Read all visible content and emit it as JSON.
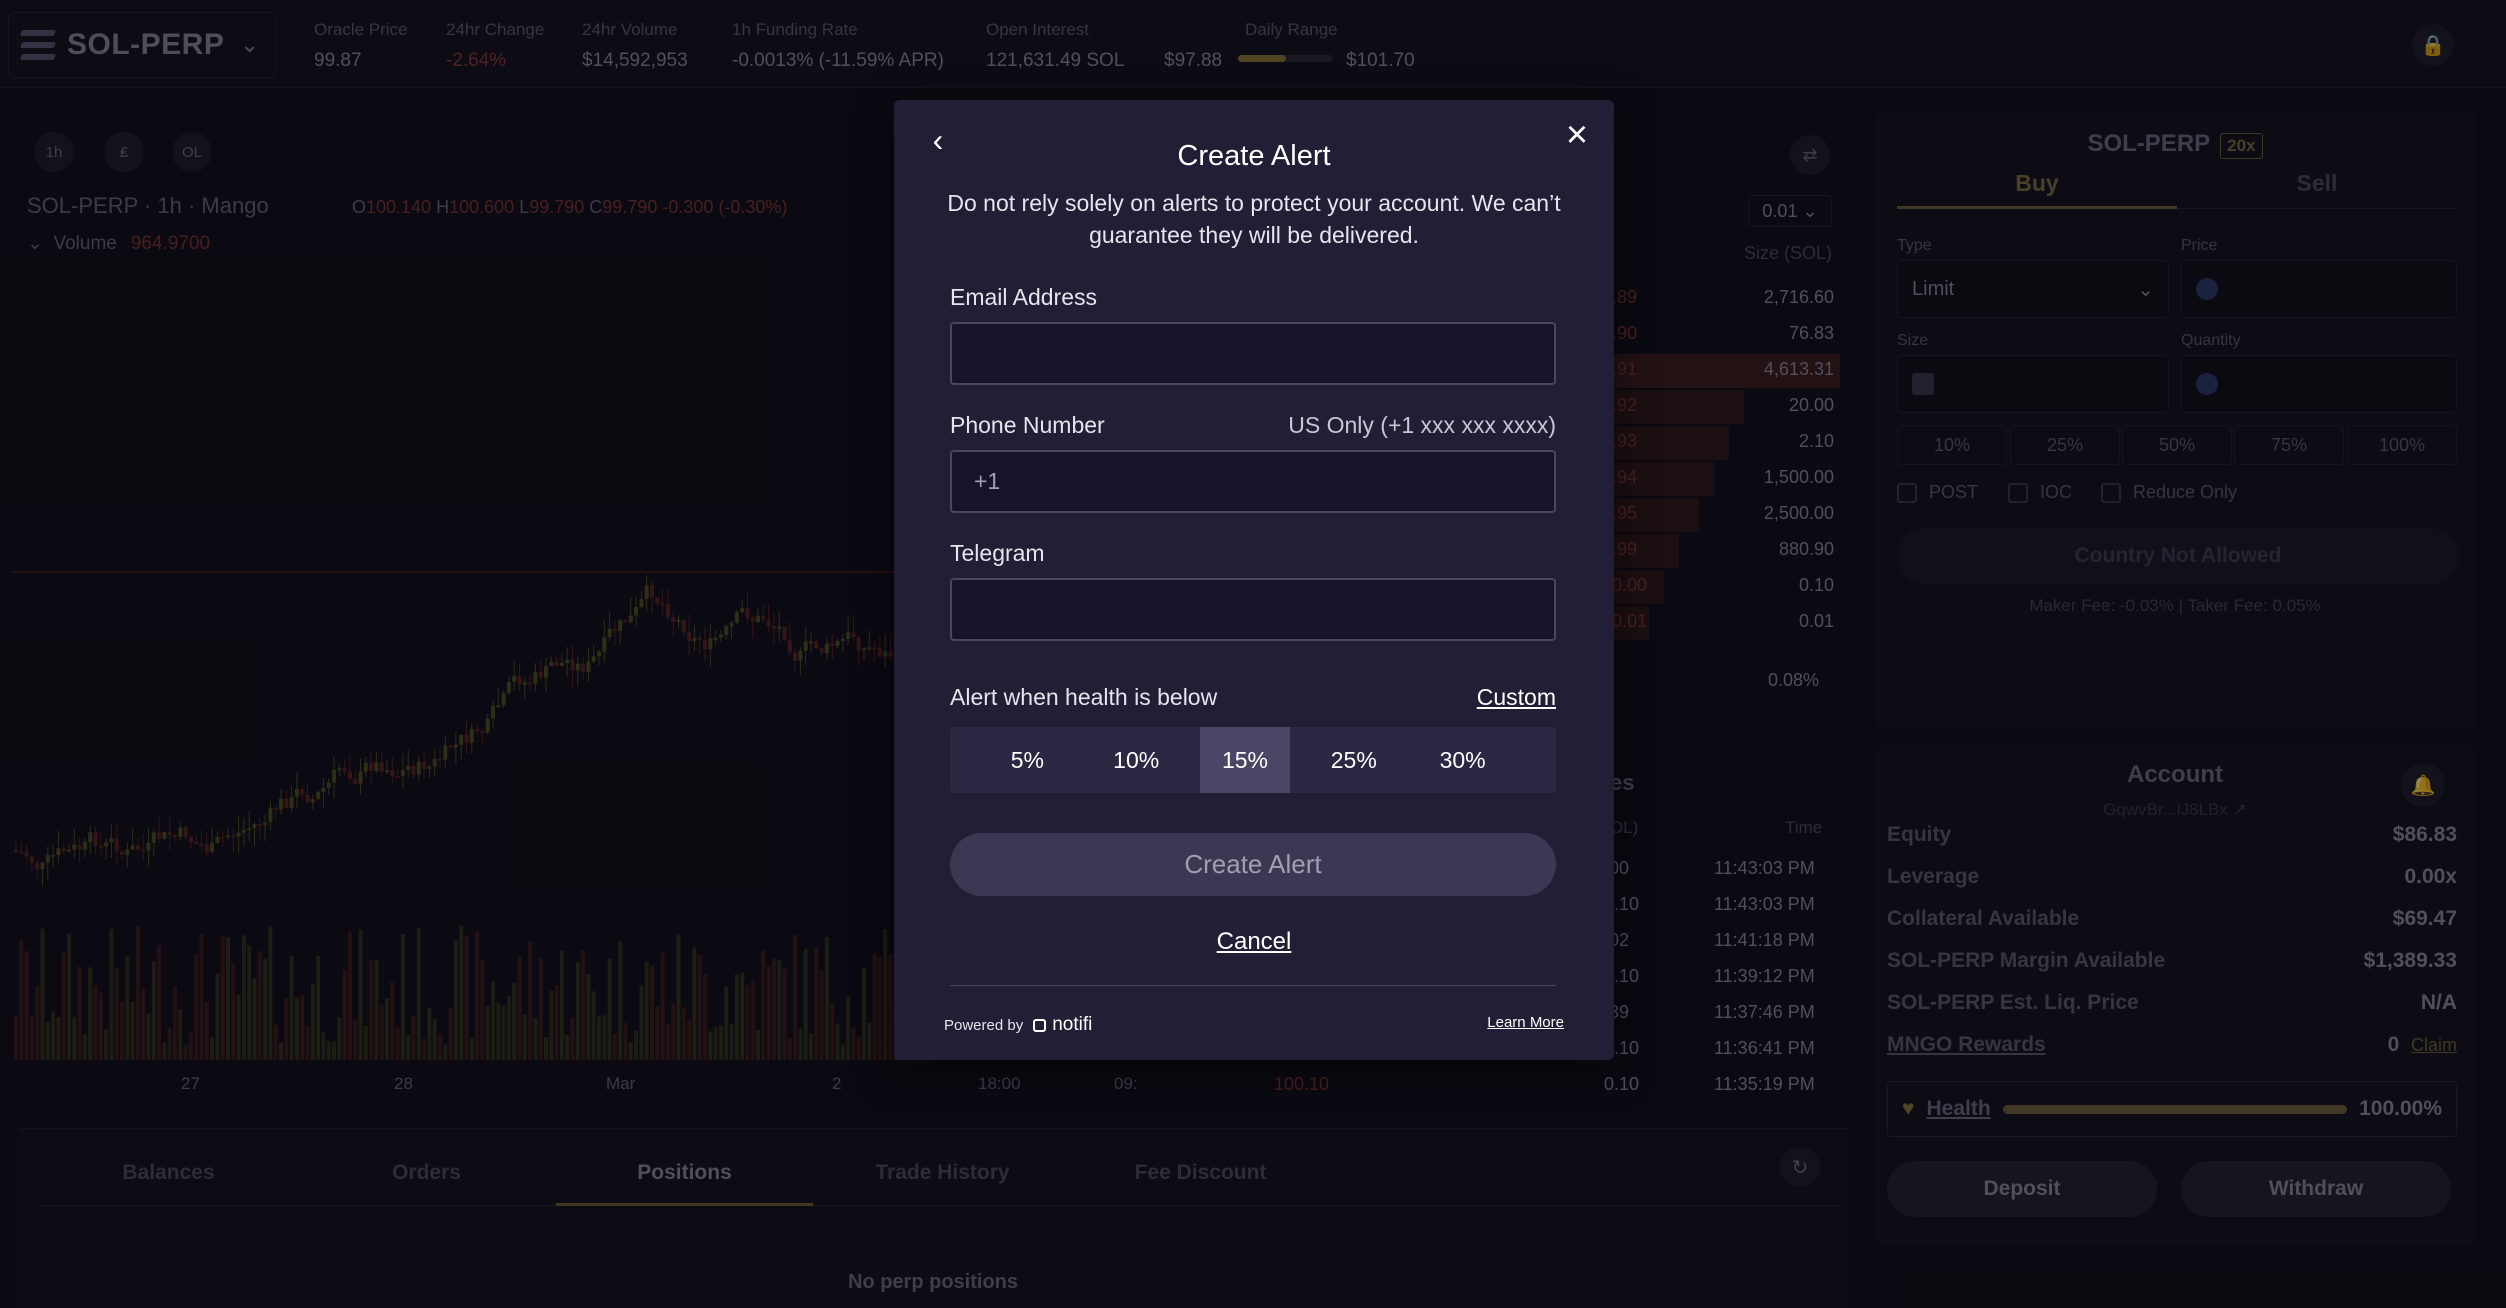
{
  "market": {
    "name": "SOL-PERP",
    "chevron_icon": "chevron-down-icon"
  },
  "stats": [
    {
      "label": "Oracle Price",
      "value": "99.87"
    },
    {
      "label": "24hr Change",
      "value": "-2.64%"
    },
    {
      "label": "24hr Volume",
      "value": "$14,592,953"
    },
    {
      "label": "1h Funding Rate",
      "value": "-0.0013% (-11.59% APR)"
    },
    {
      "label": "Open Interest",
      "value": "121,631.49 SOL"
    }
  ],
  "daily_range": {
    "label": "Daily Range",
    "low": "$97.88",
    "high": "$101.70",
    "position": 0.5
  },
  "chart": {
    "timeframe_buttons": [
      "1h",
      "₤",
      "OL"
    ],
    "title": "SOL-PERP · 1h · Mango",
    "ohlc": {
      "o_label": "O",
      "o": "100.140",
      "h_label": "H",
      "h": "100.600",
      "l_label": "L",
      "l": "99.790",
      "c_label": "C",
      "c": "99.790",
      "change": "-0.300 (-0.30%)"
    },
    "volume_label": "Volume",
    "volume_value": "964.9700",
    "x_ticks": [
      "27",
      "28",
      "Mar",
      "2",
      "18:00",
      "09:"
    ]
  },
  "orderbook": {
    "step": "0.01",
    "size_header": "Size (SOL)",
    "ask_price_fragments": [
      ".89",
      ".90",
      ".91",
      ".92",
      ".93",
      ".94",
      ".95",
      ".99",
      "0.00",
      "0.01"
    ],
    "sizes": [
      "2,716.60",
      "76.83",
      "4,613.31",
      "20.00",
      "2.10",
      "1,500.00",
      "2,500.00",
      "880.90",
      "0.10",
      "0.01"
    ],
    "spread": "0.08%"
  },
  "trades": {
    "title_fragment": "es",
    "size_header_fragment": "OL)",
    "time_header": "Time",
    "rows": [
      {
        "size": ".00",
        "time": "11:43:03 PM"
      },
      {
        "size": "0.10",
        "time": "11:43:03 PM"
      },
      {
        "size": ".02",
        "time": "11:41:18 PM"
      },
      {
        "size": "0.10",
        "time": "11:39:12 PM"
      },
      {
        "size": ".39",
        "time": "11:37:46 PM"
      },
      {
        "size": "0.10",
        "time": "11:36:41 PM"
      },
      {
        "price": "100.10",
        "size": "0.10",
        "time": "11:35:19 PM"
      }
    ]
  },
  "bottom_tabs": [
    "Balances",
    "Orders",
    "Positions",
    "Trade History",
    "Fee Discount"
  ],
  "active_tab": "Positions",
  "no_positions": "No perp positions",
  "trade_form": {
    "title": "SOL-PERP",
    "leverage": "20x",
    "buy": "Buy",
    "sell": "Sell",
    "type_label": "Type",
    "type_value": "Limit",
    "price_label": "Price",
    "size_label": "Size",
    "quantity_label": "Quantity",
    "percents": [
      "10%",
      "25%",
      "50%",
      "75%",
      "100%"
    ],
    "checkboxes": [
      "POST",
      "IOC",
      "Reduce Only"
    ],
    "submit": "Country Not Allowed",
    "fees": "Maker Fee: -0.03% | Taker Fee: 0.05%"
  },
  "account": {
    "title": "Account",
    "address": "GqwvBr...iJ8LBx",
    "rows": [
      {
        "label": "Equity",
        "value": "$86.83"
      },
      {
        "label": "Leverage",
        "value": "0.00x"
      },
      {
        "label": "Collateral Available",
        "value": "$69.47"
      },
      {
        "label": "SOL-PERP Margin Available",
        "value": "$1,389.33"
      },
      {
        "label": "SOL-PERP Est. Liq. Price",
        "value": "N/A"
      },
      {
        "label": "MNGO Rewards",
        "value": "0",
        "action": "Claim"
      }
    ],
    "health_label": "Health",
    "health_value": "100.00%",
    "health_fraction": 1.0,
    "deposit": "Deposit",
    "withdraw": "Withdraw"
  },
  "modal": {
    "title": "Create Alert",
    "warning": "Do not rely solely on alerts to protect your account. We can’t guarantee they will be delivered.",
    "email_label": "Email Address",
    "email_value": "",
    "phone_label": "Phone Number",
    "phone_hint": "US Only (+1 xxx xxx xxxx)",
    "phone_value": "+1",
    "telegram_label": "Telegram",
    "telegram_value": "",
    "health_alert_label": "Alert when health is below",
    "custom_label": "Custom",
    "thresholds": [
      "5%",
      "10%",
      "15%",
      "25%",
      "30%"
    ],
    "selected_threshold": "15%",
    "create_button": "Create Alert",
    "cancel": "Cancel",
    "powered_by": "Powered by",
    "provider": "notifi",
    "learn_more": "Learn More"
  },
  "colors": {
    "accent": "#6e6238",
    "negative": "#8a3a3a",
    "modal_bg": "#211e35",
    "selected_segment": "#4a4666"
  }
}
